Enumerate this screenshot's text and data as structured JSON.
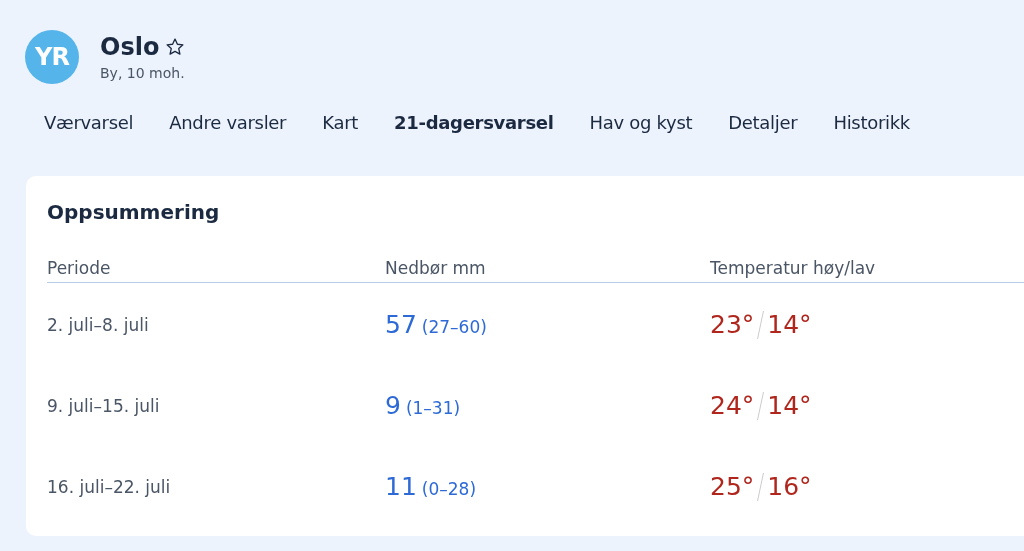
{
  "header": {
    "logo": "YR",
    "title": "Oslo",
    "favorite": false,
    "subtitle": "By, 10 moh."
  },
  "tabs": [
    {
      "label": "Værvarsel",
      "selected": false
    },
    {
      "label": "Andre varsler",
      "selected": false
    },
    {
      "label": "Kart",
      "selected": false
    },
    {
      "label": "21-dagersvarsel",
      "selected": true
    },
    {
      "label": "Hav og kyst",
      "selected": false
    },
    {
      "label": "Detaljer",
      "selected": false
    },
    {
      "label": "Historikk",
      "selected": false
    }
  ],
  "summary": {
    "title": "Oppsummering",
    "columns": [
      "Periode",
      "Nedbør mm",
      "Temperatur høy/lav"
    ],
    "rows": [
      {
        "period": "2. juli–8. juli",
        "precip": "57",
        "range": "(27–60)",
        "high": "23°",
        "low": "14°"
      },
      {
        "period": "9. juli–15. juli",
        "precip": "9",
        "range": "(1–31)",
        "high": "24°",
        "low": "14°"
      },
      {
        "period": "16. juli–22. juli",
        "precip": "11",
        "range": "(0–28)",
        "high": "25°",
        "low": "16°"
      }
    ]
  }
}
